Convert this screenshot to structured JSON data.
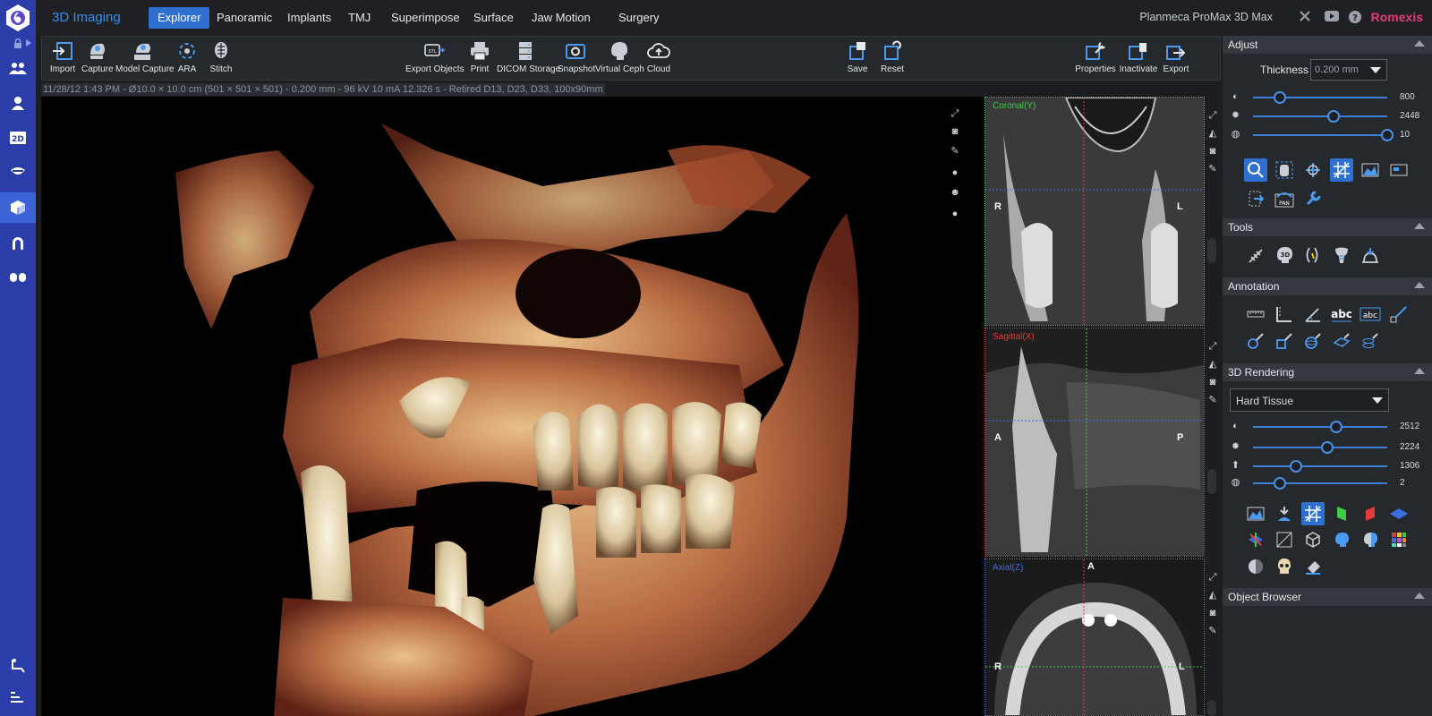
{
  "app": {
    "title": "3D Imaging",
    "device": "Planmeca ProMax 3D Max",
    "brand": "Romexis"
  },
  "tabs": [
    "Explorer",
    "Panoramic",
    "Implants",
    "TMJ",
    "Superimpose",
    "Surface",
    "Jaw Motion",
    "Surgery"
  ],
  "active_tab": "Explorer",
  "toolbar": {
    "left": [
      "Import",
      "Capture",
      "Model Capture",
      "ARA",
      "Stitch"
    ],
    "middle": [
      "Export Objects",
      "Print",
      "DICOM Storage",
      "Snapshot",
      "Virtual Ceph",
      "Cloud"
    ],
    "save_group": [
      "Save",
      "Reset"
    ],
    "right": [
      "Properties",
      "Inactivate",
      "Export"
    ]
  },
  "info_line": "11/28/12 1:43 PM - Ø10.0 × 10.0 cm (501 × 501 × 501) - 0.200 mm - 96 kV 10 mA 12.326 s - Retired D13, D23, D33, 100x90mm",
  "slices": {
    "coronal": {
      "title": "Coronal(Y)",
      "left": "R",
      "right": "L",
      "color": "#3ecc46"
    },
    "sagittal": {
      "title": "Sagittal(X)",
      "left": "A",
      "right": "P",
      "color": "#e23b3b"
    },
    "axial": {
      "title": "Axial(Z)",
      "top": "A",
      "left": "R",
      "right": "L",
      "color": "#3b6ee2"
    }
  },
  "panel": {
    "adjust": {
      "title": "Adjust",
      "thickness_label": "Thickness",
      "thickness_value": "0.200 mm",
      "sliders": [
        {
          "icon": "contrast-icon",
          "value": "800",
          "level": 0.2
        },
        {
          "icon": "brightness-icon",
          "value": "2448",
          "level": 0.6
        },
        {
          "icon": "gamma-icon",
          "value": "10",
          "level": 1.0
        }
      ]
    },
    "tools": {
      "title": "Tools"
    },
    "annotation": {
      "title": "Annotation"
    },
    "rendering": {
      "title": "3D Rendering",
      "preset": "Hard Tissue",
      "sliders": [
        {
          "icon": "contrast-icon",
          "value": "2512",
          "level": 0.62
        },
        {
          "icon": "brightness-icon",
          "value": "2224",
          "level": 0.55
        },
        {
          "icon": "threshold-icon",
          "value": "1306",
          "level": 0.32
        },
        {
          "icon": "gamma-icon",
          "value": "2",
          "level": 0.2
        }
      ]
    },
    "object_browser": {
      "title": "Object Browser"
    }
  }
}
